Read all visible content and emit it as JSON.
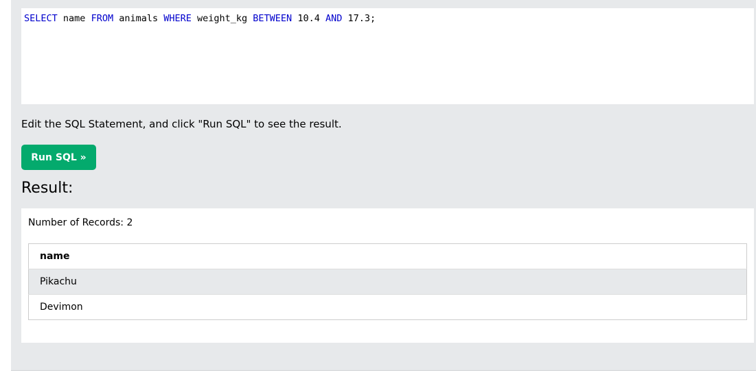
{
  "editor": {
    "sql_tokens": [
      {
        "text": "SELECT",
        "keyword": true
      },
      {
        "text": " name ",
        "keyword": false
      },
      {
        "text": "FROM",
        "keyword": true
      },
      {
        "text": " animals ",
        "keyword": false
      },
      {
        "text": "WHERE",
        "keyword": true
      },
      {
        "text": " weight_kg ",
        "keyword": false
      },
      {
        "text": "BETWEEN",
        "keyword": true
      },
      {
        "text": " 10.4 ",
        "keyword": false
      },
      {
        "text": "AND",
        "keyword": true
      },
      {
        "text": " 17.3;",
        "keyword": false
      }
    ]
  },
  "instructions": "Edit the SQL Statement, and click \"Run SQL\" to see the result.",
  "run_button": {
    "label": "Run SQL »"
  },
  "result": {
    "heading": "Result:",
    "record_count": "Number of Records: 2",
    "columns": [
      "name"
    ],
    "rows": [
      [
        "Pikachu"
      ],
      [
        "Devimon"
      ]
    ]
  },
  "colors": {
    "panel_bg": "#e7e9eb",
    "button_bg": "#04aa6d",
    "keyword": "#0000cd"
  }
}
